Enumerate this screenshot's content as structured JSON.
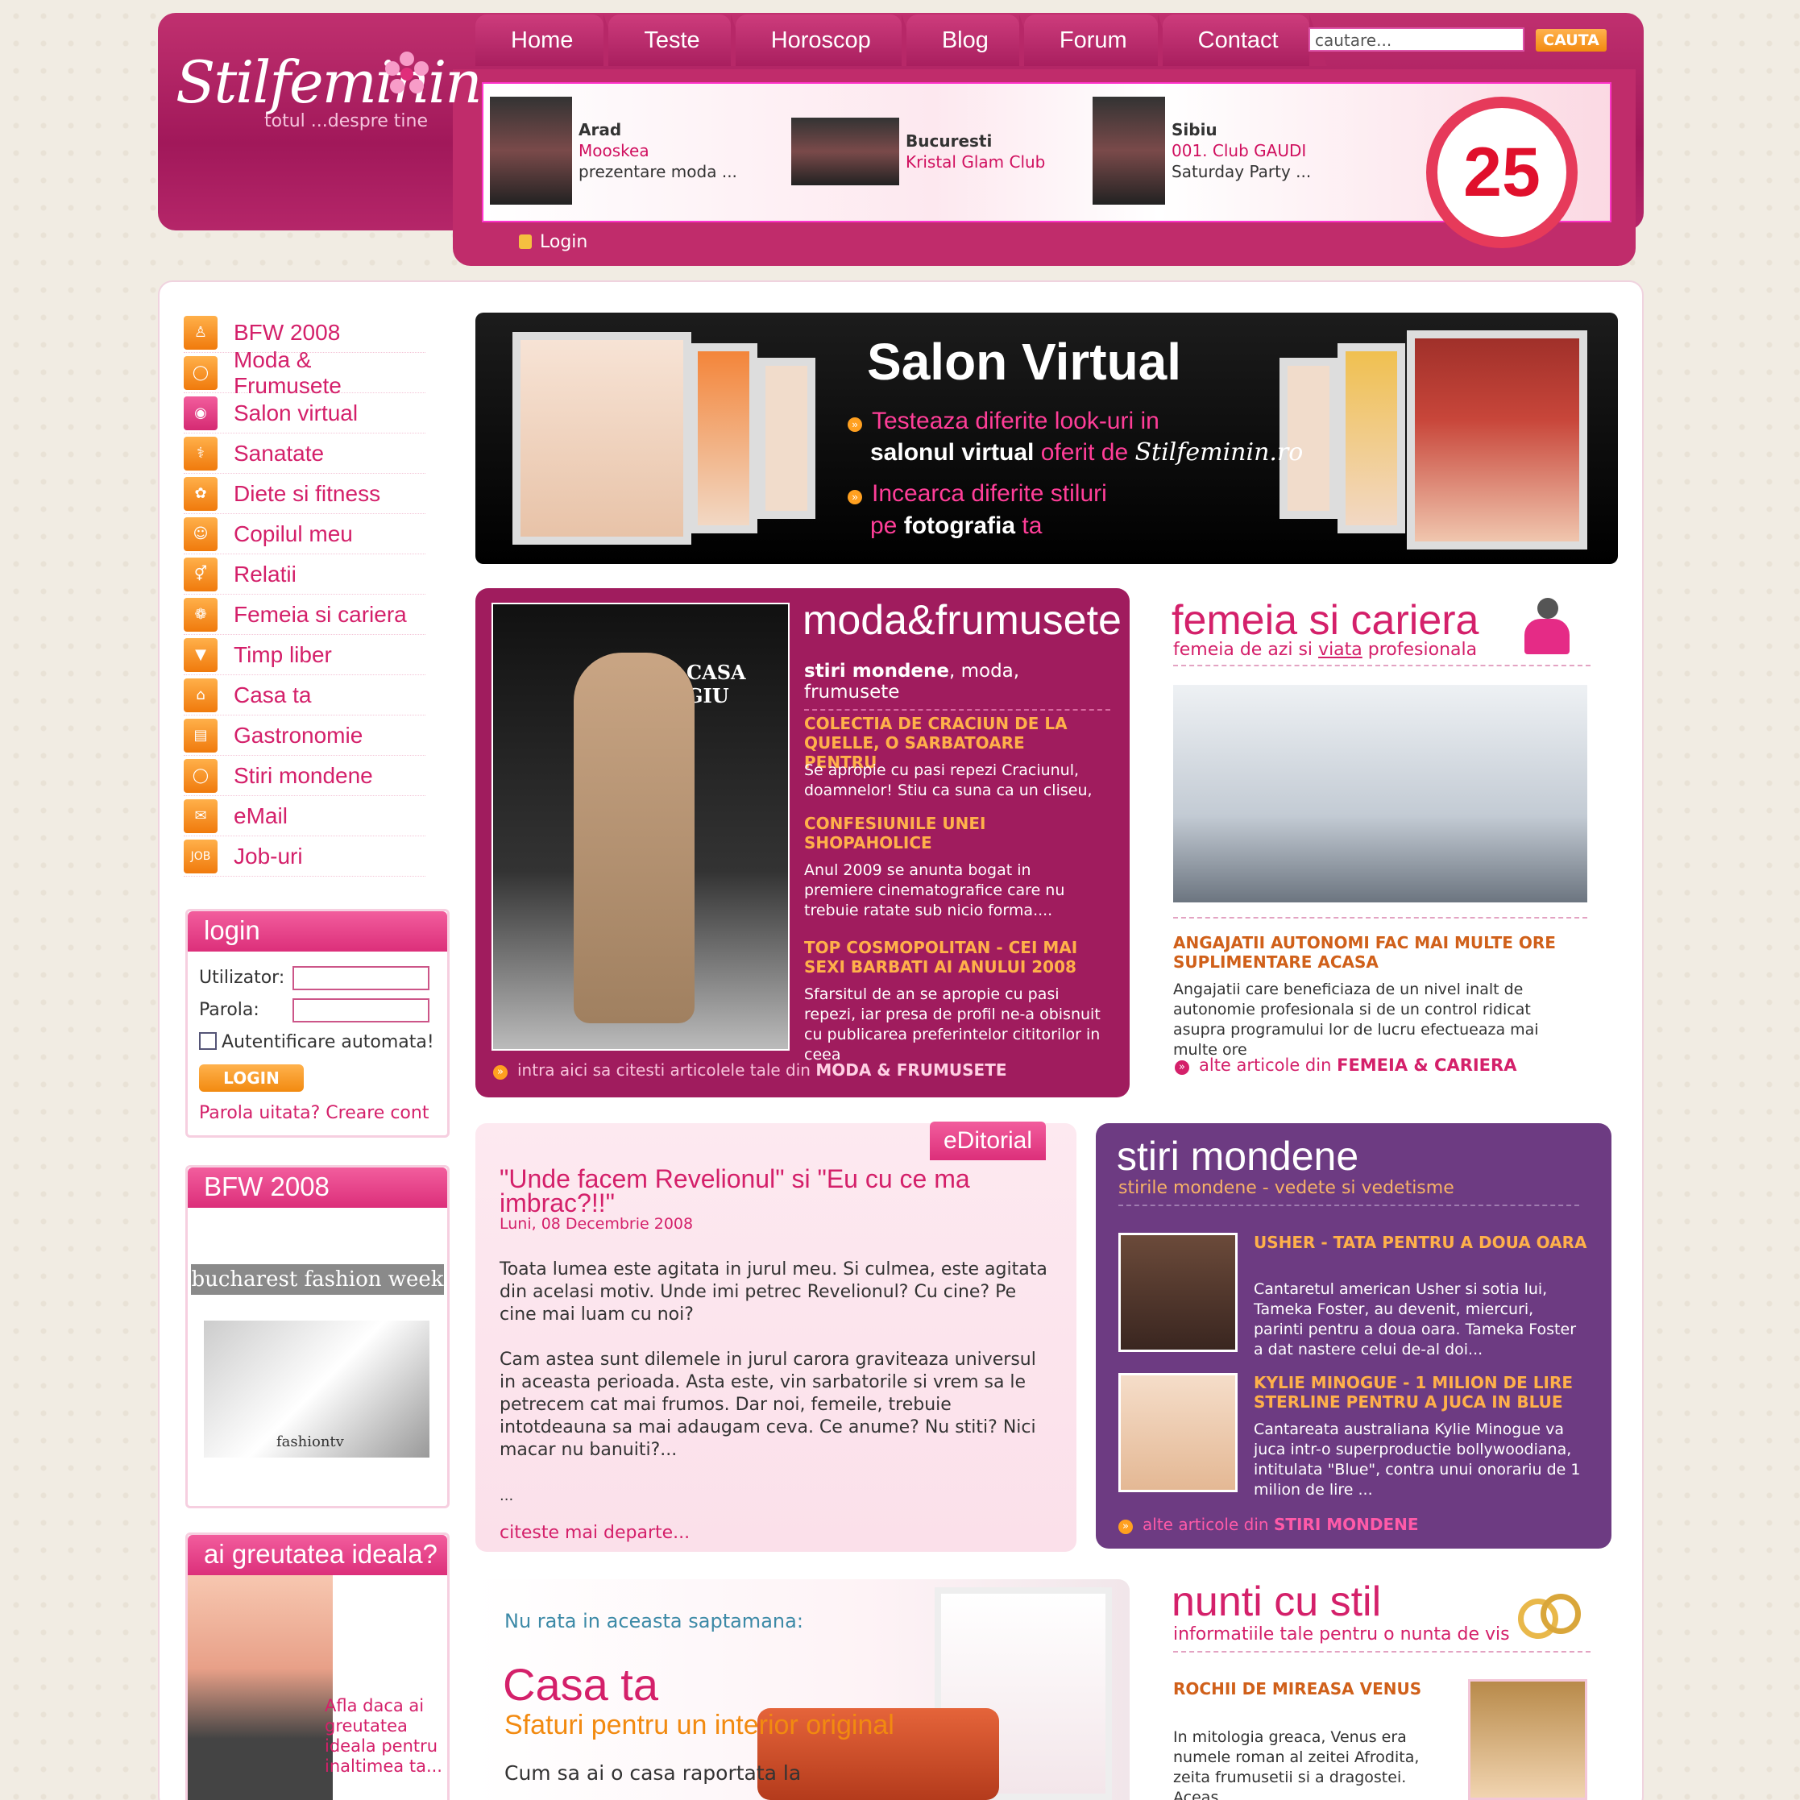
{
  "nav": [
    "Home",
    "Teste",
    "Horoscop",
    "Blog",
    "Forum",
    "Contact"
  ],
  "search": {
    "placeholder": "cautare...",
    "button": "CAUTA"
  },
  "logo": {
    "name": "Stilfeminin",
    "tagline": "totul ...despre tine"
  },
  "events": [
    {
      "city": "Arad",
      "venue": "Mooskea",
      "desc": "prezentare moda ..."
    },
    {
      "city": "Bucuresti",
      "venue": "Kristal Glam Club",
      "desc": ""
    },
    {
      "city": "Sibiu",
      "venue": "001. Club GAUDI",
      "desc": "Saturday Party ..."
    }
  ],
  "badge": "25",
  "top_login": "Login",
  "menu": [
    {
      "label": "BFW 2008",
      "icon": "model-icon"
    },
    {
      "label": "Moda & Frumusete",
      "icon": "hat-icon"
    },
    {
      "label": "Salon virtual",
      "icon": "eye-icon"
    },
    {
      "label": "Sanatate",
      "icon": "health-icon"
    },
    {
      "label": "Diete si fitness",
      "icon": "diet-icon"
    },
    {
      "label": "Copilul meu",
      "icon": "child-icon"
    },
    {
      "label": "Relatii",
      "icon": "gender-icon"
    },
    {
      "label": "Femeia si cariera",
      "icon": "flower-icon"
    },
    {
      "label": "Timp liber",
      "icon": "cocktail-icon"
    },
    {
      "label": "Casa ta",
      "icon": "house-icon"
    },
    {
      "label": "Gastronomie",
      "icon": "book-icon"
    },
    {
      "label": "Stiri mondene",
      "icon": "plate-icon"
    },
    {
      "label": "eMail",
      "icon": "envelope-icon"
    },
    {
      "label": "Job-uri",
      "icon": "job-icon"
    }
  ],
  "login": {
    "title": "login",
    "user": "Utilizator:",
    "pass": "Parola:",
    "auto": "Autentificare automata!",
    "button": "LOGIN",
    "links": "Parola uitata? Creare cont"
  },
  "bfw": {
    "title": "BFW 2008",
    "headline": "bucharest fashion week",
    "brand": "fashiontv"
  },
  "greutate": {
    "title": "ai greutatea ideala?",
    "text": "Afla daca ai greutatea ideala pentru inaltimea ta..."
  },
  "salon": {
    "title": "Salon Virtual",
    "l1a": "Testeaza diferite look-uri in",
    "l1b": "salonul virtual",
    "l1c": "oferit de",
    "l2a": "Incearca diferite stiluri",
    "l2b": "pe",
    "l2c": "fotografia",
    "l2d": "ta",
    "logo": "Stilfeminin.ro"
  },
  "moda": {
    "title": "moda&frumusete",
    "sub_a": "stiri mondene",
    "sub_b": ", moda, frumusete",
    "a1t": "COLECTIA DE CRACIUN DE LA QUELLE, O SARBATOARE PENTRU",
    "a1x": "Se apropie cu pasi repezi Craciunul, doamnelor! Stiu ca suna ca un cliseu,",
    "a2t": "CONFESIUNILE UNEI SHOPAHOLICE",
    "a2x": "Anul 2009 se anunta bogat in premiere cinematografice care nu trebuie ratate sub nicio forma....",
    "a3t": "TOP COSMOPOLITAN - CEI MAI SEXI BARBATI AI ANULUI 2008",
    "a3x": "Sfarsitul de an se apropie cu pasi repezi, iar presa de profil ne-a obisnuit cu publicarea preferintelor cititorilor in ceea",
    "more_a": "intra aici sa citesti articolele tale din",
    "more_b": "MODA & FRUMUSETE",
    "photo_text": "CASA GIU"
  },
  "cariera": {
    "title": "femeia si cariera",
    "sub_a": "femeia de azi si",
    "sub_b": "viata",
    "sub_c": "profesionala",
    "head": "ANGAJATII AUTONOMI FAC MAI MULTE ORE SUPLIMENTARE ACASA",
    "text": "Angajatii care beneficiaza de un nivel inalt de autonomie profesionala si de un control ridicat asupra programului lor de lucru efectueaza mai multe ore",
    "more_a": "alte articole din",
    "more_b": "FEMEIA & CARIERA"
  },
  "editorial": {
    "tag": "eDitorial",
    "title": "\"Unde facem Revelionul\" si \"Eu cu ce ma imbrac?!!\"",
    "date": "Luni, 08 Decembrie 2008",
    "p1": "Toata lumea este agitata in jurul meu. Si culmea, este agitata din acelasi motiv. Unde imi petrec Revelionul? Cu cine? Pe cine mai luam cu noi?",
    "p2": "Cam astea sunt dilemele in jurul carora graviteaza universul in aceasta perioada. Asta este, vin sarbatorile si vrem sa le petrecem cat mai frumos. Dar noi, femeile, trebuie intotdeauna sa mai adaugam ceva. Ce anume? Nu stiti? Nici macar nu banuiti?...",
    "dots": "...",
    "more": "citeste mai departe..."
  },
  "stiri": {
    "title": "stiri mondene",
    "sub": "stirile mondene - vedete si vedetisme",
    "a1t": "USHER - TATA PENTRU A DOUA OARA",
    "a1x": "Cantaretul american Usher si sotia lui, Tameka Foster, au devenit, miercuri, parinti pentru a doua oara. Tameka Foster a dat nastere celui de-al doi...",
    "a2t": "KYLIE MINOGUE - 1 MILION DE LIRE STERLINE PENTRU A JUCA IN BLUE",
    "a2x": "Cantareata australiana Kylie Minogue va juca intr-o superproductie bollywoodiana, intitulata \"Blue\", contra unui onorariu de 1 milion de lire ...",
    "more_a": "alte articole din",
    "more_b": "STIRI MONDENE"
  },
  "casa": {
    "pre": "Nu rata in aceasta saptamana:",
    "title": "Casa ta",
    "sub": "Sfaturi pentru un interior original",
    "text": "Cum sa ai o casa raportata la"
  },
  "nunti": {
    "title": "nunti cu stil",
    "sub": "informatiile tale pentru o nunta de vis",
    "head": "ROCHII DE MIREASA VENUS",
    "text": "In mitologia greaca, Venus era numele roman al zeitei Afrodita, zeita frumusetii si a dragostei. Aceas..."
  },
  "colors": {
    "brand": "#b52669",
    "pink": "#d4206a",
    "orange": "#f28a10",
    "purple": "#6d3b82"
  }
}
